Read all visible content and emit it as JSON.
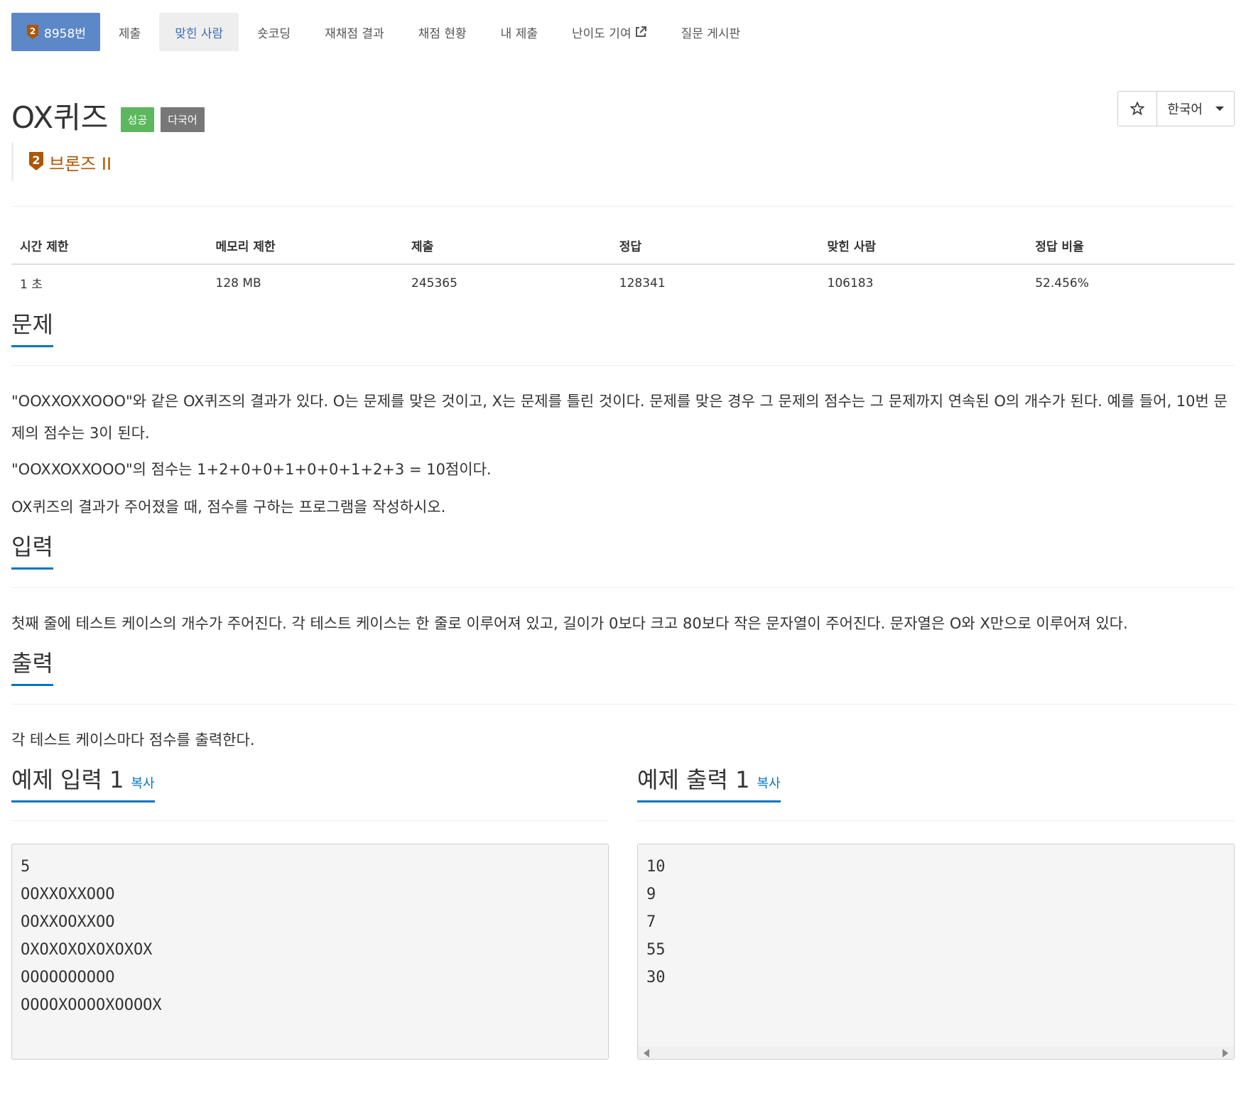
{
  "nav": {
    "tabs": [
      {
        "label": "8958번",
        "icon": "bronze-tier-icon",
        "variant": "primary"
      },
      {
        "label": "제출",
        "variant": "default"
      },
      {
        "label": "맞힌 사람",
        "variant": "active"
      },
      {
        "label": "숏코딩",
        "variant": "default"
      },
      {
        "label": "재채점 결과",
        "variant": "default"
      },
      {
        "label": "채점 현황",
        "variant": "default"
      },
      {
        "label": "내 제출",
        "variant": "default"
      },
      {
        "label": "난이도 기여",
        "icon": "external-link-icon",
        "variant": "default"
      },
      {
        "label": "질문 게시판",
        "variant": "default"
      }
    ]
  },
  "problem": {
    "title": "OX퀴즈",
    "badges": [
      "성공",
      "다국어"
    ],
    "tier": {
      "label": "브론즈 II",
      "icon": "bronze-tier-icon",
      "color": "#ad5600"
    },
    "language_select": "한국어",
    "star_icon": "star-icon"
  },
  "stats": {
    "headers": [
      "시간 제한",
      "메모리 제한",
      "제출",
      "정답",
      "맞힌 사람",
      "정답 비율"
    ],
    "values": [
      "1 초",
      "128 MB",
      "245365",
      "128341",
      "106183",
      "52.456%"
    ]
  },
  "sections": {
    "problem": {
      "title": "문제",
      "paragraphs": [
        "\"OOXXOXXOOO\"와 같은 OX퀴즈의 결과가 있다. O는 문제를 맞은 것이고, X는 문제를 틀린 것이다. 문제를 맞은 경우 그 문제의 점수는 그 문제까지 연속된 O의 개수가 된다. 예를 들어, 10번 문제의 점수는 3이 된다.",
        "\"OOXXOXXOOO\"의 점수는 1+2+0+0+1+0+0+1+2+3 = 10점이다.",
        "OX퀴즈의 결과가 주어졌을 때, 점수를 구하는 프로그램을 작성하시오."
      ]
    },
    "input": {
      "title": "입력",
      "paragraphs": [
        "첫째 줄에 테스트 케이스의 개수가 주어진다. 각 테스트 케이스는 한 줄로 이루어져 있고, 길이가 0보다 크고 80보다 작은 문자열이 주어진다. 문자열은 O와 X만으로 이루어져 있다."
      ]
    },
    "output": {
      "title": "출력",
      "paragraphs": [
        "각 테스트 케이스마다 점수를 출력한다."
      ]
    }
  },
  "samples": {
    "input": {
      "title": "예제 입력 1",
      "copy_label": "복사",
      "text": "5\nOOXXOXXOOO\nOOXXOOXXOO\nOXOXOXOXOXOXOX\nOOOOOOOOOO\nOOOOXOOOOXOOOOX"
    },
    "output": {
      "title": "예제 출력 1",
      "copy_label": "복사",
      "text": "10\n9\n7\n55\n30"
    }
  },
  "colors": {
    "primary_tab": "#5c88c8",
    "active_tab_text": "#3a6fb5",
    "link": "#0076c0",
    "success_badge": "#5cb85c",
    "multi_badge": "#777777",
    "tier": "#ad5600"
  }
}
